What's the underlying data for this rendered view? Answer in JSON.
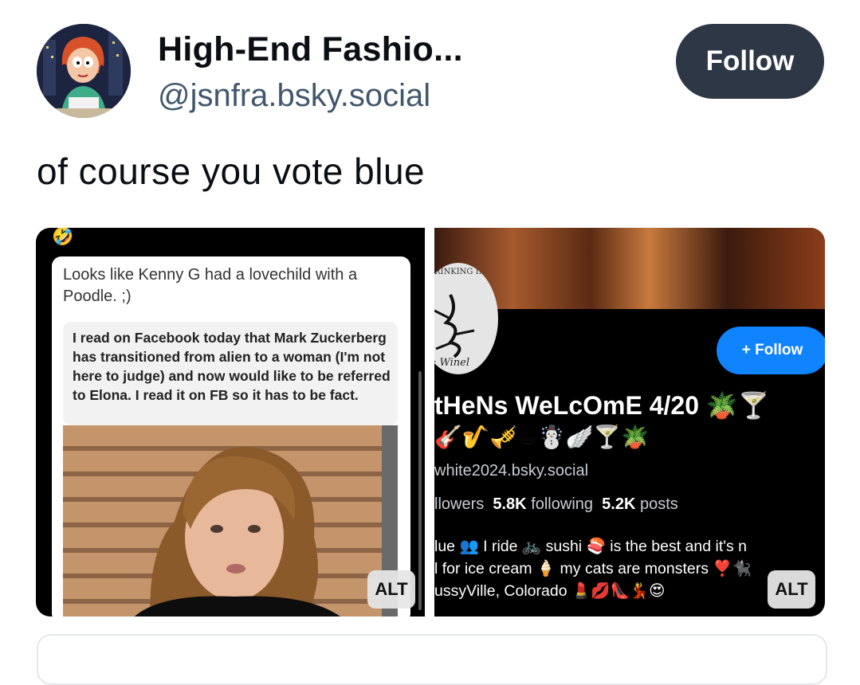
{
  "post": {
    "author_name": "High-End Fashio...",
    "author_handle": "@jsnfra.bsky.social",
    "follow_label": "Follow",
    "text": "of course you vote blue"
  },
  "images": [
    {
      "alt_label": "ALT",
      "emoji": "🤣",
      "caption": "Looks like Kenny G had a lovechild with a Poodle. ;)",
      "quote": "I read on Facebook today that Mark Zuckerberg has transitioned from alien to a woman (I'm not here to judge) and now would like to be referred to Elona. I read it on FB so it has to be fact."
    },
    {
      "alt_label": "ALT",
      "avatar_text_top": "RINKING IN",
      "avatar_text_bottom": ": Winel",
      "follow_label": "+ Follow",
      "profile_name": "tHeNs WeLcOmE 4/20 🪴🍸",
      "emoji_row": "🎸🎷🎺☕☃️🪽🍸🪴",
      "handle": "white2024.bsky.social",
      "stats": {
        "followers_label": "llowers",
        "following_count": "5.8K",
        "following_label": "following",
        "posts_count": "5.2K",
        "posts_label": "posts"
      },
      "bio_line1": "lue 👥 I ride 🚲 sushi 🍣 is the best and it's n",
      "bio_line2": "l for ice cream 🍦 my cats are monsters ❣️🐈‍⬛",
      "bio_line3": "ussyVille, Colorado 💄💋👠💃😍"
    }
  ],
  "colors": {
    "follow_bg": "#2d3745",
    "inner_follow_bg": "#1083fe",
    "handle": "#42576c"
  }
}
